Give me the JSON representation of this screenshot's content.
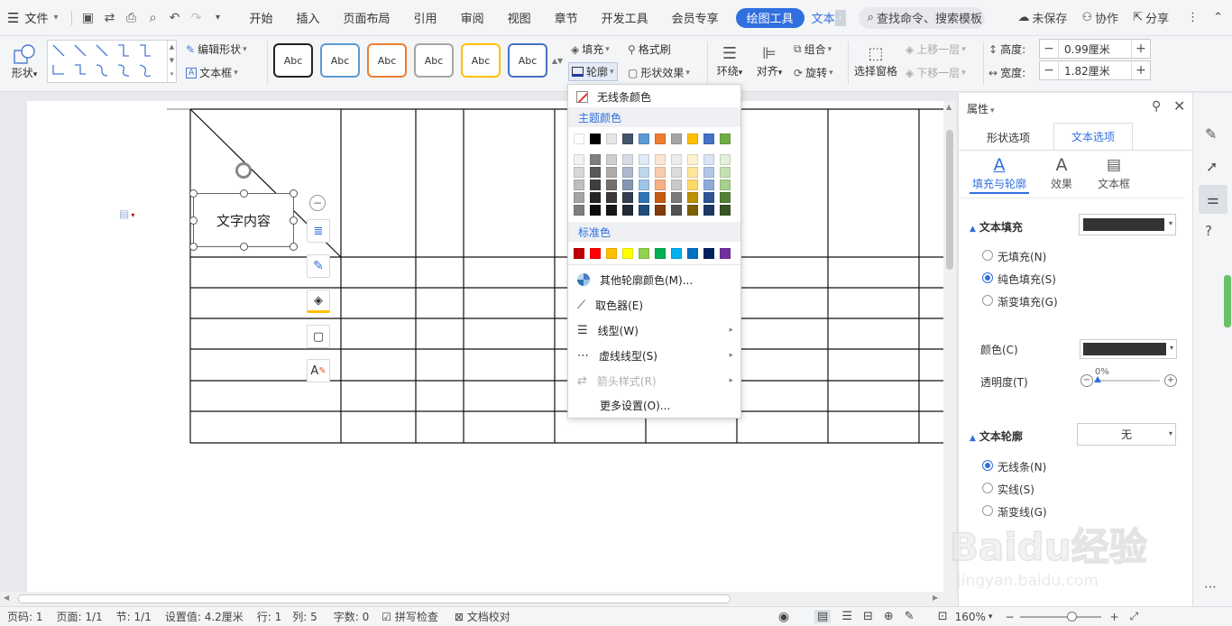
{
  "menubar": {
    "file_label": "文件",
    "tabs": [
      "开始",
      "插入",
      "页面布局",
      "引用",
      "审阅",
      "视图",
      "章节",
      "开发工具",
      "会员专享"
    ],
    "active_tab": "绘图工具",
    "next_tab": "文本",
    "search_label": "查找命令、搜索模板",
    "unsaved_label": "未保存",
    "collab_label": "协作",
    "share_label": "分享"
  },
  "ribbon": {
    "shape_label": "形状",
    "edit_shape_label": "编辑形状",
    "textbox_label": "文本框",
    "style_samples": [
      "Abc",
      "Abc",
      "Abc",
      "Abc",
      "Abc",
      "Abc"
    ],
    "style_colors": [
      "#222222",
      "#5b9bd5",
      "#ed7d31",
      "#a5a5a5",
      "#ffc000",
      "#4472c4"
    ],
    "fill_label": "填充",
    "format_brush_label": "格式刷",
    "outline_label": "轮廓",
    "shape_effect_label": "形状效果",
    "wrap_label": "环绕",
    "align_label": "对齐",
    "group_label": "组合",
    "rotate_label": "旋转",
    "selection_pane_label": "选择窗格",
    "bring_forward_label": "上移一层",
    "send_backward_label": "下移一层",
    "height_label": "高度:",
    "height_value": "0.99厘米",
    "width_label": "宽度:",
    "width_value": "1.82厘米"
  },
  "document": {
    "textbox_text": "文字内容"
  },
  "dropdown": {
    "no_line_color": "无线条颜色",
    "theme_colors_header": "主题颜色",
    "standard_colors_header": "标准色",
    "theme_top_row": [
      "#ffffff",
      "#000000",
      "#e7e6e6",
      "#44546a",
      "#5b9bd5",
      "#ed7d31",
      "#a5a5a5",
      "#ffc000",
      "#4472c4",
      "#70ad47"
    ],
    "theme_shades": [
      [
        "#f2f2f2",
        "#7f7f7f",
        "#d0cece",
        "#d6dce4",
        "#deebf6",
        "#fbe5d5",
        "#ededed",
        "#fff2cc",
        "#dae3f3",
        "#e2efd9"
      ],
      [
        "#d8d8d8",
        "#595959",
        "#aeabab",
        "#adb9ca",
        "#bdd7ee",
        "#f7cbac",
        "#dbdbdb",
        "#fee599",
        "#b4c6e7",
        "#c5e0b3"
      ],
      [
        "#bfbfbf",
        "#3f3f3f",
        "#757070",
        "#8496b0",
        "#9dc3e6",
        "#f4b183",
        "#c9c9c9",
        "#ffd965",
        "#8eaadb",
        "#a8d08d"
      ],
      [
        "#a5a5a5",
        "#262626",
        "#3a3838",
        "#323f4f",
        "#2e75b5",
        "#c55a11",
        "#7b7b7b",
        "#bf9000",
        "#2f5496",
        "#538135"
      ],
      [
        "#7f7f7f",
        "#0c0c0c",
        "#171616",
        "#222a35",
        "#1e4e79",
        "#833c0b",
        "#525252",
        "#7f6000",
        "#1f3864",
        "#375623"
      ]
    ],
    "standard_colors": [
      "#c00000",
      "#ff0000",
      "#ffc000",
      "#ffff00",
      "#92d050",
      "#00b050",
      "#00b0f0",
      "#0070c0",
      "#002060",
      "#7030a0"
    ],
    "more_colors": "其他轮廓颜色(M)...",
    "eyedropper": "取色器(E)",
    "line_style": "线型(W)",
    "dash_style": "虚线线型(S)",
    "arrow_style": "箭头样式(R)",
    "more_settings": "更多设置(O)..."
  },
  "pane": {
    "title": "属性",
    "tab_shape": "形状选项",
    "tab_text": "文本选项",
    "sub_fill_outline": "填充与轮廓",
    "sub_effect": "效果",
    "sub_textbox": "文本框",
    "text_fill_header": "文本填充",
    "no_fill": "无填充(N)",
    "solid_fill": "纯色填充(S)",
    "gradient_fill": "渐变填充(G)",
    "color_label": "颜色(C)",
    "transparency_label": "透明度(T)",
    "transparency_value": "0%",
    "text_outline_header": "文本轮廓",
    "outline_value": "无",
    "no_line": "无线条(N)",
    "solid_line": "实线(S)",
    "gradient_line": "渐变线(G)",
    "fill_color": "#333333"
  },
  "statusbar": {
    "page": "页码: 1",
    "pages": "页面: 1/1",
    "section": "节: 1/1",
    "setting": "设置值: 4.2厘米",
    "row": "行: 1",
    "col": "列: 5",
    "words": "字数: 0",
    "spell": "拼写检查",
    "proof": "文档校对",
    "zoom": "160%"
  },
  "watermark": {
    "brand": "Baidu经验",
    "url": "jingyan.baidu.com"
  }
}
